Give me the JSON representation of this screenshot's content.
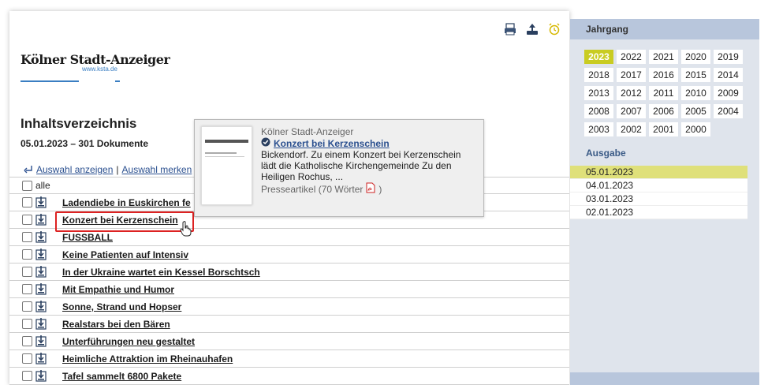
{
  "logo": {
    "name": "Kölner Stadt-Anzeiger",
    "url": "www.ksta.de"
  },
  "header": {
    "title": "Inhaltsverzeichnis",
    "subtitle": "05.01.2023 – 301 Dokumente"
  },
  "actions": {
    "show_selection": "Auswahl anzeigen",
    "separator": "|",
    "remember_selection": "Auswahl merken"
  },
  "list": {
    "all_label": "alle",
    "items": [
      "Ladendiebe in Euskirchen fe",
      "Konzert bei Kerzenschein",
      "FUSSBALL",
      "Keine Patienten auf Intensiv",
      "In der Ukraine wartet ein Kessel Borschtsch",
      "Mit Empathie und Humor",
      "Sonne, Strand und Hopser",
      "Realstars bei den Bären",
      "Unterführungen neu gestaltet",
      "Heimliche Attraktion im Rheinauhafen",
      "Tafel sammelt 6800 Pakete"
    ]
  },
  "tooltip": {
    "source": "Kölner Stadt-Anzeiger",
    "title": "Konzert bei Kerzenschein",
    "text": "Bickendorf. Zu einem Konzert bei Kerzenschein lädt die Katholische Kirchengemeinde Zu den Heiligen Rochus, ...",
    "meta": "Presseartikel (70 Wörter",
    "meta_end": ")",
    "thumb_logo": "Kölner Stadt-Anzeiger"
  },
  "sidebar": {
    "year_heading": "Jahrgang",
    "years": [
      "2023",
      "2022",
      "2021",
      "2020",
      "2019",
      "2018",
      "2017",
      "2016",
      "2015",
      "2014",
      "2013",
      "2012",
      "2011",
      "2010",
      "2009",
      "2008",
      "2007",
      "2006",
      "2005",
      "2004",
      "2003",
      "2002",
      "2001",
      "2000"
    ],
    "active_year": "2023",
    "issue_heading": "Ausgabe",
    "dates": [
      "05.01.2023",
      "04.01.2023",
      "03.01.2023",
      "02.01.2023"
    ],
    "active_date": "05.01.2023"
  },
  "colors": {
    "accent_year": "#c9cc22",
    "accent_date": "#dfe07a",
    "link": "#2a4f8f",
    "highlight": "#dd2222"
  },
  "icons": [
    "print-icon",
    "export-icon",
    "alarm-clock-icon",
    "download-icon",
    "checkmark-badge-icon",
    "pdf-icon",
    "hand-cursor-icon",
    "corner-arrow-icon"
  ]
}
